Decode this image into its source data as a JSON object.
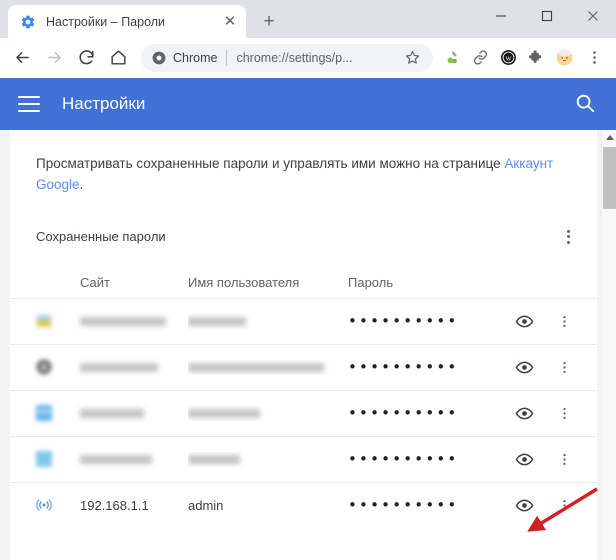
{
  "window": {
    "controls": {
      "minimize": "–",
      "maximize": "□",
      "close": "✕"
    }
  },
  "tab": {
    "title": "Настройки – Пароли",
    "favicon": "gear-icon",
    "close_label": "✕",
    "newtab_label": "+"
  },
  "toolbar": {
    "back": "←",
    "forward": "→",
    "reload": "⟳",
    "home": "⌂",
    "omnibox": {
      "chrome_icon": "chrome-icon",
      "label": "Chrome",
      "url": "chrome://settings/p...",
      "star": "star-icon"
    },
    "extensions": [
      {
        "name": "extension-icon-green",
        "glyph": "🔬"
      },
      {
        "name": "link-icon",
        "glyph": "🔗"
      },
      {
        "name": "w-badge-icon",
        "glyph": "Ⓦ"
      },
      {
        "name": "puzzle-icon",
        "glyph": "🧩"
      },
      {
        "name": "profile-avatar",
        "glyph": "👤"
      }
    ],
    "menu": "⋮"
  },
  "settings_header": {
    "menu_icon": "hamburger-icon",
    "title": "Настройки",
    "search_icon": "search-icon",
    "bg_color": "#4071d7"
  },
  "content": {
    "info_text_before": "Просматривать сохраненные пароли и управлять ими можно на странице ",
    "info_link": "Аккаунт Google",
    "info_text_after": ".",
    "link_color": "#5b8def",
    "section_title": "Сохраненные пароли",
    "section_menu": "⋮",
    "columns": {
      "site": "Сайт",
      "username": "Имя пользователя",
      "password": "Пароль"
    },
    "rows": [
      {
        "site": "",
        "username": "",
        "password_mask": "••••••••••",
        "redacted": true,
        "favicon_color": "#e8c41e",
        "eye": "eye-icon",
        "menu": "⋮"
      },
      {
        "site": "",
        "username": "",
        "password_mask": "••••••••••",
        "redacted": true,
        "favicon_color": "#5f6368",
        "eye": "eye-icon",
        "menu": "⋮"
      },
      {
        "site": "",
        "username": "",
        "password_mask": "••••••••••",
        "redacted": true,
        "favicon_color": "#66b7e8",
        "eye": "eye-icon",
        "menu": "⋮"
      },
      {
        "site": "",
        "username": "",
        "password_mask": "••••••••••",
        "redacted": true,
        "favicon_color": "#7ec8ea",
        "eye": "eye-icon",
        "menu": "⋮"
      },
      {
        "site": "192.168.1.1",
        "username": "admin",
        "password_mask": "••••••••••",
        "redacted": false,
        "favicon_color": "#4a90d9",
        "eye": "eye-icon",
        "menu": "⋮"
      }
    ]
  },
  "annotation": {
    "arrow_color": "#d32020",
    "target": "show-password-eye-icon-last-row"
  },
  "scrollbar": {
    "up": "▲",
    "down": "▼"
  }
}
